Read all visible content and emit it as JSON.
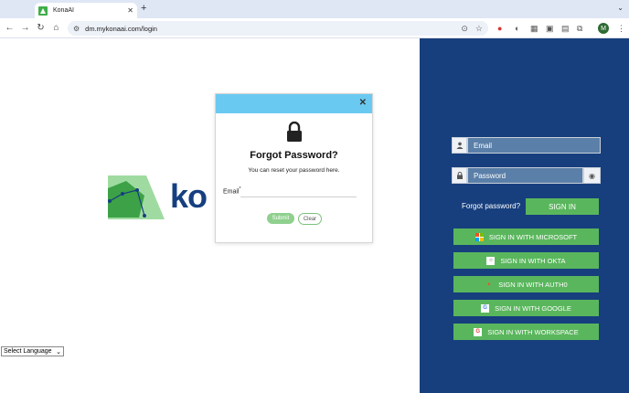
{
  "browser": {
    "tab_title": "KonaAI",
    "tab_close": "✕",
    "new_tab": "+",
    "tab_menu": "⌄",
    "url": "dm.mykonaai.com/login",
    "profile_initial": "M"
  },
  "page": {
    "logo_text": "ko",
    "language_select": "Select Language"
  },
  "login": {
    "email_placeholder": "Email",
    "password_placeholder": "Password",
    "forgot_link": "Forgot password?",
    "signin_label": "SIGN IN",
    "sso": [
      {
        "label": "SIGN IN WITH MICROSOFT",
        "icon": "microsoft-icon"
      },
      {
        "label": "SIGN IN WITH OKTA",
        "icon": "okta-icon"
      },
      {
        "label": "SIGN IN WITH AUTH0",
        "icon": "auth0-icon"
      },
      {
        "label": "SIGN IN WITH GOOGLE",
        "icon": "google-icon"
      },
      {
        "label": "SIGN IN WITH WORKSPACE",
        "icon": "workspace-icon"
      }
    ]
  },
  "modal": {
    "title": "Forgot Password?",
    "subtitle": "You can reset your password here.",
    "email_label": "Email",
    "required_mark": "*",
    "submit_label": "Submit",
    "clear_label": "Clear",
    "close": "✕"
  },
  "colors": {
    "panel": "#173f7d",
    "button_green": "#5ab65d",
    "modal_header": "#6ac9f1",
    "logo_blue": "#153f80"
  }
}
